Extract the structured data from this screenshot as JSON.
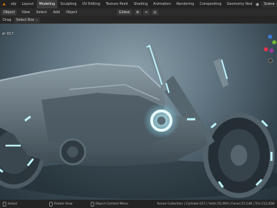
{
  "topbar": {
    "logo_glyph": "▲",
    "tabs": [
      "elp",
      "Layout",
      "Modeling",
      "Sculpting",
      "UV Editing",
      "Texture Paint",
      "Shading",
      "Animation",
      "Rendering",
      "Compositing",
      "Geometry Nod"
    ],
    "active_tab_index": 2,
    "scene_icon": "scene-icon",
    "scene_label": "Scene"
  },
  "header2": {
    "mode_label": "Object",
    "menu": [
      "View",
      "Select",
      "Add",
      "Object"
    ],
    "transform_label": "Global",
    "pivot_glyph": "⊕",
    "snap_glyph": "⌖",
    "proportional_glyph": "◎"
  },
  "header3": {
    "drag_label": "Drag",
    "select_box_label": "Select Box",
    "dropdown_glyph": "⌵"
  },
  "viewport": {
    "view_name": "er 017",
    "accent_glow": "#7fe6ff",
    "gizmo_colors": {
      "x": "#e0364f",
      "y": "#6fb33a",
      "z": "#3d7ad6",
      "neg": "#9a3a9a"
    }
  },
  "statusbar": {
    "left_action": "Select",
    "middle_label": "Rotate View",
    "right_label": "Object Context Menu",
    "stats": "Scene Collection | Cylinder.017 | Verts:55,993 | Faces:57,148 | Tris:112,458"
  }
}
